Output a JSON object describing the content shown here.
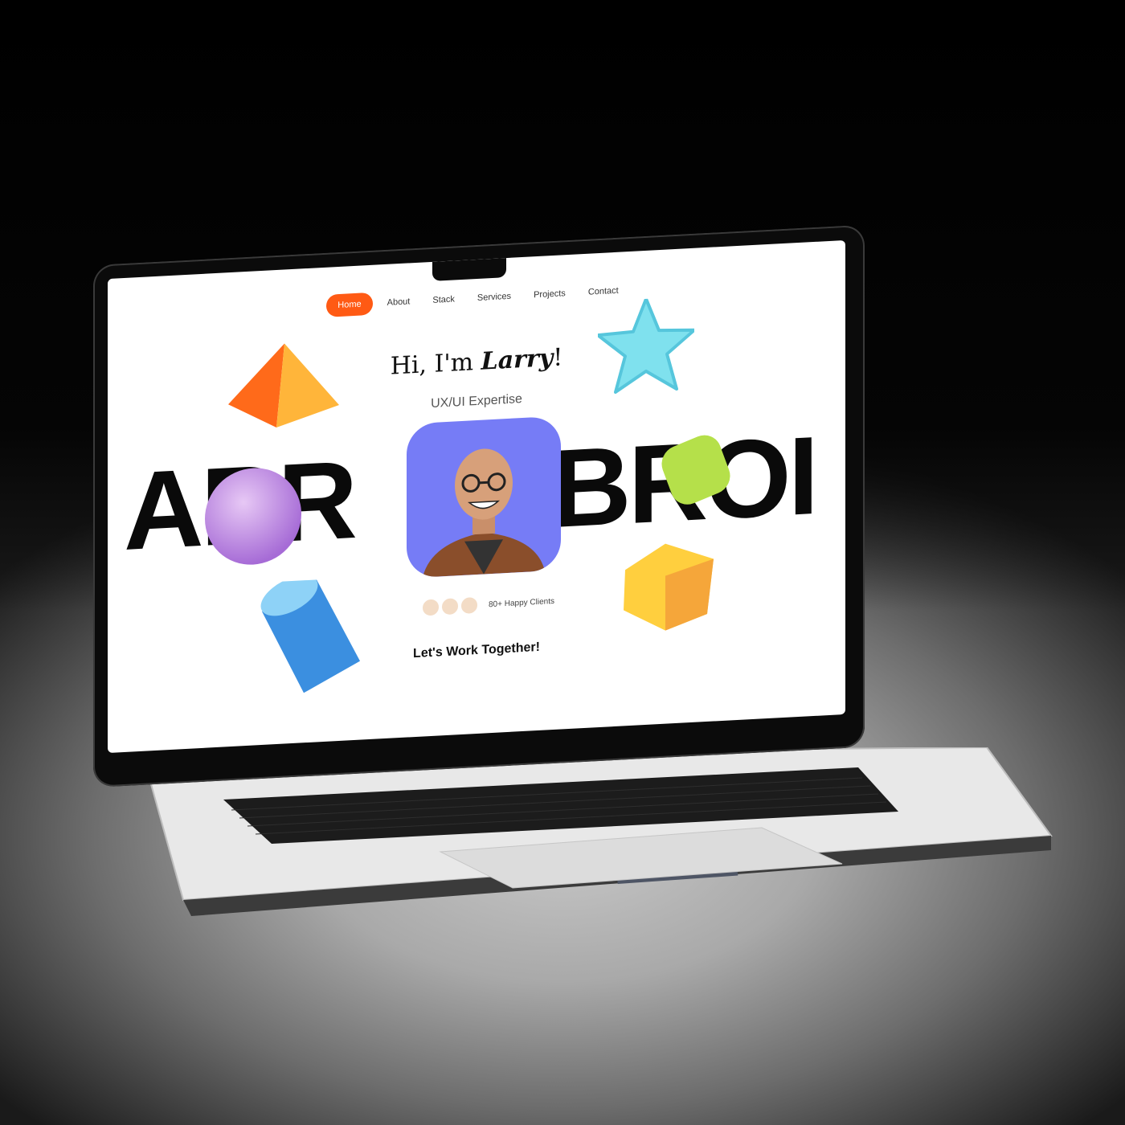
{
  "nav": {
    "items": [
      {
        "label": "Home",
        "active": true
      },
      {
        "label": "About"
      },
      {
        "label": "Stack"
      },
      {
        "label": "Services"
      },
      {
        "label": "Projects"
      },
      {
        "label": "Contact"
      }
    ]
  },
  "hero": {
    "greeting_prefix": "Hi, I'm ",
    "greeting_name": "Larry",
    "greeting_suffix": "!",
    "subtitle": "UX/UI Expertise",
    "big_word_left": "ARR",
    "big_word_right": "BROI",
    "clients_label": "80+ Happy Clients",
    "cta": "Let's Work Together!"
  },
  "colors": {
    "accent": "#ff5a14",
    "portrait_bg": "#767cf6"
  }
}
